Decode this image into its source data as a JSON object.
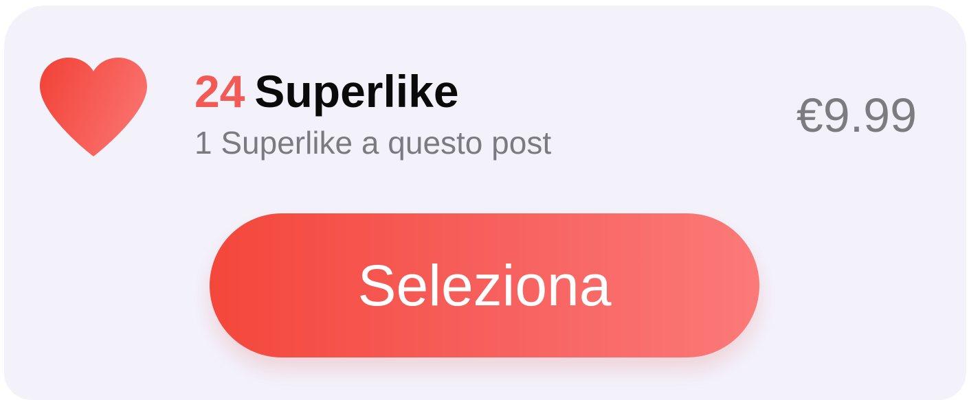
{
  "offer": {
    "count": "24",
    "title": "Superlike",
    "subtitle": "1 Superlike a questo post",
    "price": "€9.99",
    "icon": "heart-icon"
  },
  "actions": {
    "select_label": "Seleziona"
  },
  "colors": {
    "accent": "#f25a55",
    "button_gradient_start": "#f4473b",
    "button_gradient_end": "#fb7a78",
    "card_background": "#f3f2fb",
    "secondary_text": "#7a7a7f"
  }
}
